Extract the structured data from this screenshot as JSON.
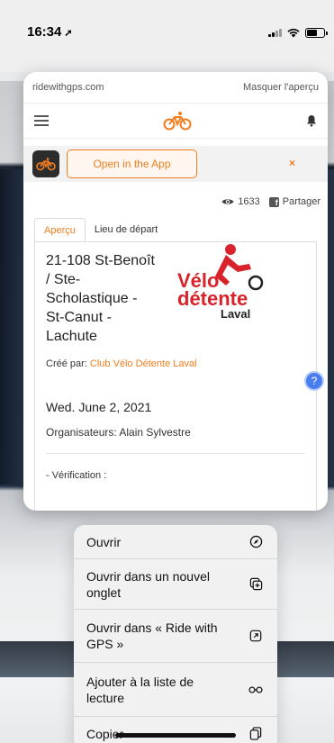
{
  "status_bar": {
    "time": "16:34",
    "location_glyph": "➚"
  },
  "preview": {
    "url": "ridewithgps.com",
    "hide_preview": "Masquer l'aperçu",
    "banner": {
      "open_in_app": "Open in the App",
      "close": "×"
    },
    "stats": {
      "views": "1633",
      "share": "Partager"
    },
    "tabs": [
      {
        "label": "Aperçu",
        "active": true
      },
      {
        "label": "Lieu de départ",
        "active": false
      }
    ],
    "route": {
      "title": "21-108 St-Benoît / Ste-Scholastique - St-Canut - Lachute",
      "created_by_label": "Créé par:",
      "created_by_club": "Club Vélo Détente Laval",
      "date": "Wed. June 2, 2021",
      "organizers": "Organisateurs: Alain Sylvestre",
      "verification": "- Vérification :"
    },
    "club_logo": {
      "line1": "Vélo",
      "line2": "détente",
      "line3": "Laval"
    },
    "help_glyph": "?"
  },
  "context_menu": {
    "items": [
      {
        "label": "Ouvrir",
        "icon": "compass-icon"
      },
      {
        "label": "Ouvrir dans un nouvel onglet",
        "icon": "new-tab-icon"
      },
      {
        "label": "Ouvrir dans « Ride with GPS »",
        "icon": "open-external-icon"
      },
      {
        "label": "Ajouter à la liste de lecture",
        "icon": "glasses-icon"
      },
      {
        "label": "Copier",
        "icon": "copy-icon"
      }
    ]
  },
  "colors": {
    "accent": "#f07d1f",
    "club_red": "#d8232a",
    "help_blue": "#4a7ef0"
  }
}
